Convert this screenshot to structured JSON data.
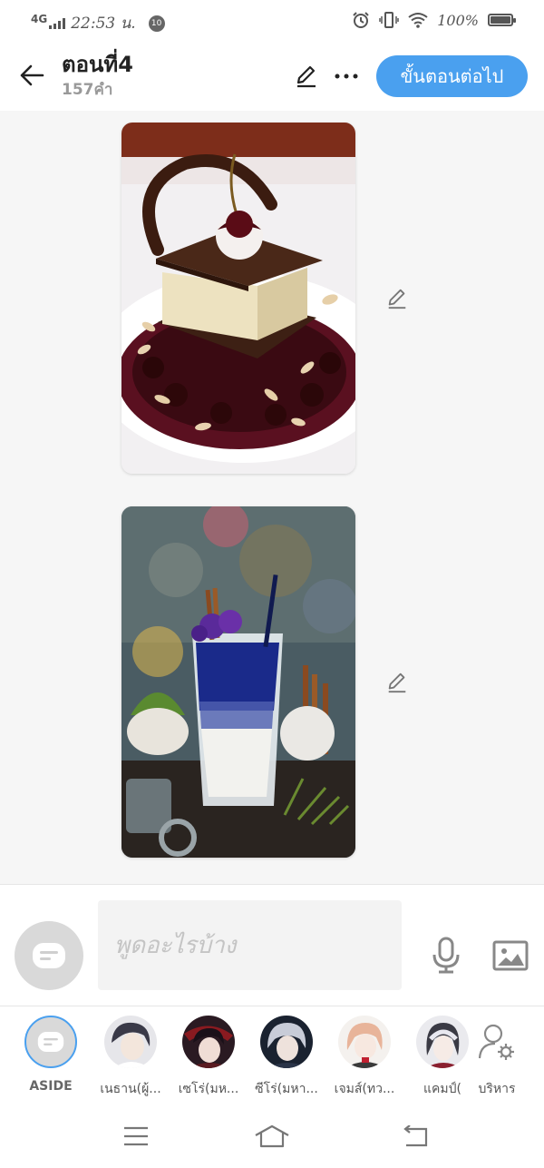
{
  "status_bar": {
    "network": "4G",
    "time": "22:53 น.",
    "notification_count": "10",
    "battery": "100%"
  },
  "header": {
    "title": "ตอนที่4",
    "word_count": "157คำ",
    "next_button": "ขั้นตอนต่อไป"
  },
  "images": [
    {
      "alt": "chocolate-cherry-dessert"
    },
    {
      "alt": "butterfly-pea-iced-drink"
    }
  ],
  "input": {
    "placeholder": "พูดอะไรบ้าง"
  },
  "characters": [
    {
      "label": "ASIDE"
    },
    {
      "label": "เนธาน(ผู้..."
    },
    {
      "label": "เซโร่(มห..."
    },
    {
      "label": "ซีโร่(มหา..."
    },
    {
      "label": "เจมส์(ทว..."
    },
    {
      "label": "แคมป์("
    },
    {
      "label": "บริหาร"
    }
  ],
  "colors": {
    "accent": "#4aa0ef",
    "background": "#f6f6f6"
  },
  "icons": {
    "back": "arrow-left-icon",
    "edit": "pencil-icon",
    "more": "more-dots-icon",
    "mic": "microphone-icon",
    "image": "image-icon",
    "manage": "user-gear-icon"
  }
}
